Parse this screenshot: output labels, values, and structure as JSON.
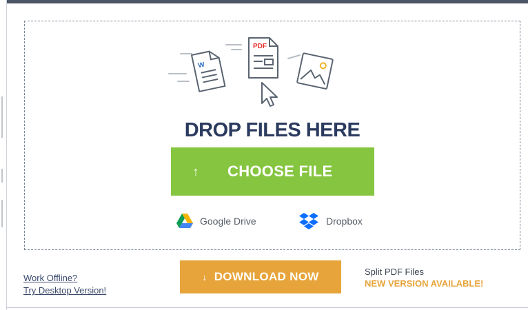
{
  "drop_zone": {
    "title": "DROP FILES HERE",
    "choose_button": {
      "arrow": "↑",
      "label": "CHOOSE FILE"
    },
    "illustration": {
      "pdf_tag": "PDF",
      "word_tag": "W"
    },
    "cloud_sources": [
      {
        "label": "Google Drive",
        "icon": "google-drive-icon"
      },
      {
        "label": "Dropbox",
        "icon": "dropbox-icon"
      }
    ]
  },
  "footer": {
    "offline_link": "Work Offline?",
    "desktop_link": "Try Desktop Version!",
    "download_button": {
      "arrow": "↓",
      "label": "DOWNLOAD NOW"
    },
    "promo": {
      "line1": "Split PDF Files",
      "line2": "NEW VERSION AVAILABLE!"
    }
  },
  "colors": {
    "title": "#2b3a5e",
    "choose_green": "#86c540",
    "download_orange": "#e7a43a",
    "illustration_stroke": "#5a6470",
    "pdf_red": "#e5322d",
    "word_blue": "#2b6cc4",
    "image_orange": "#f0b429"
  }
}
